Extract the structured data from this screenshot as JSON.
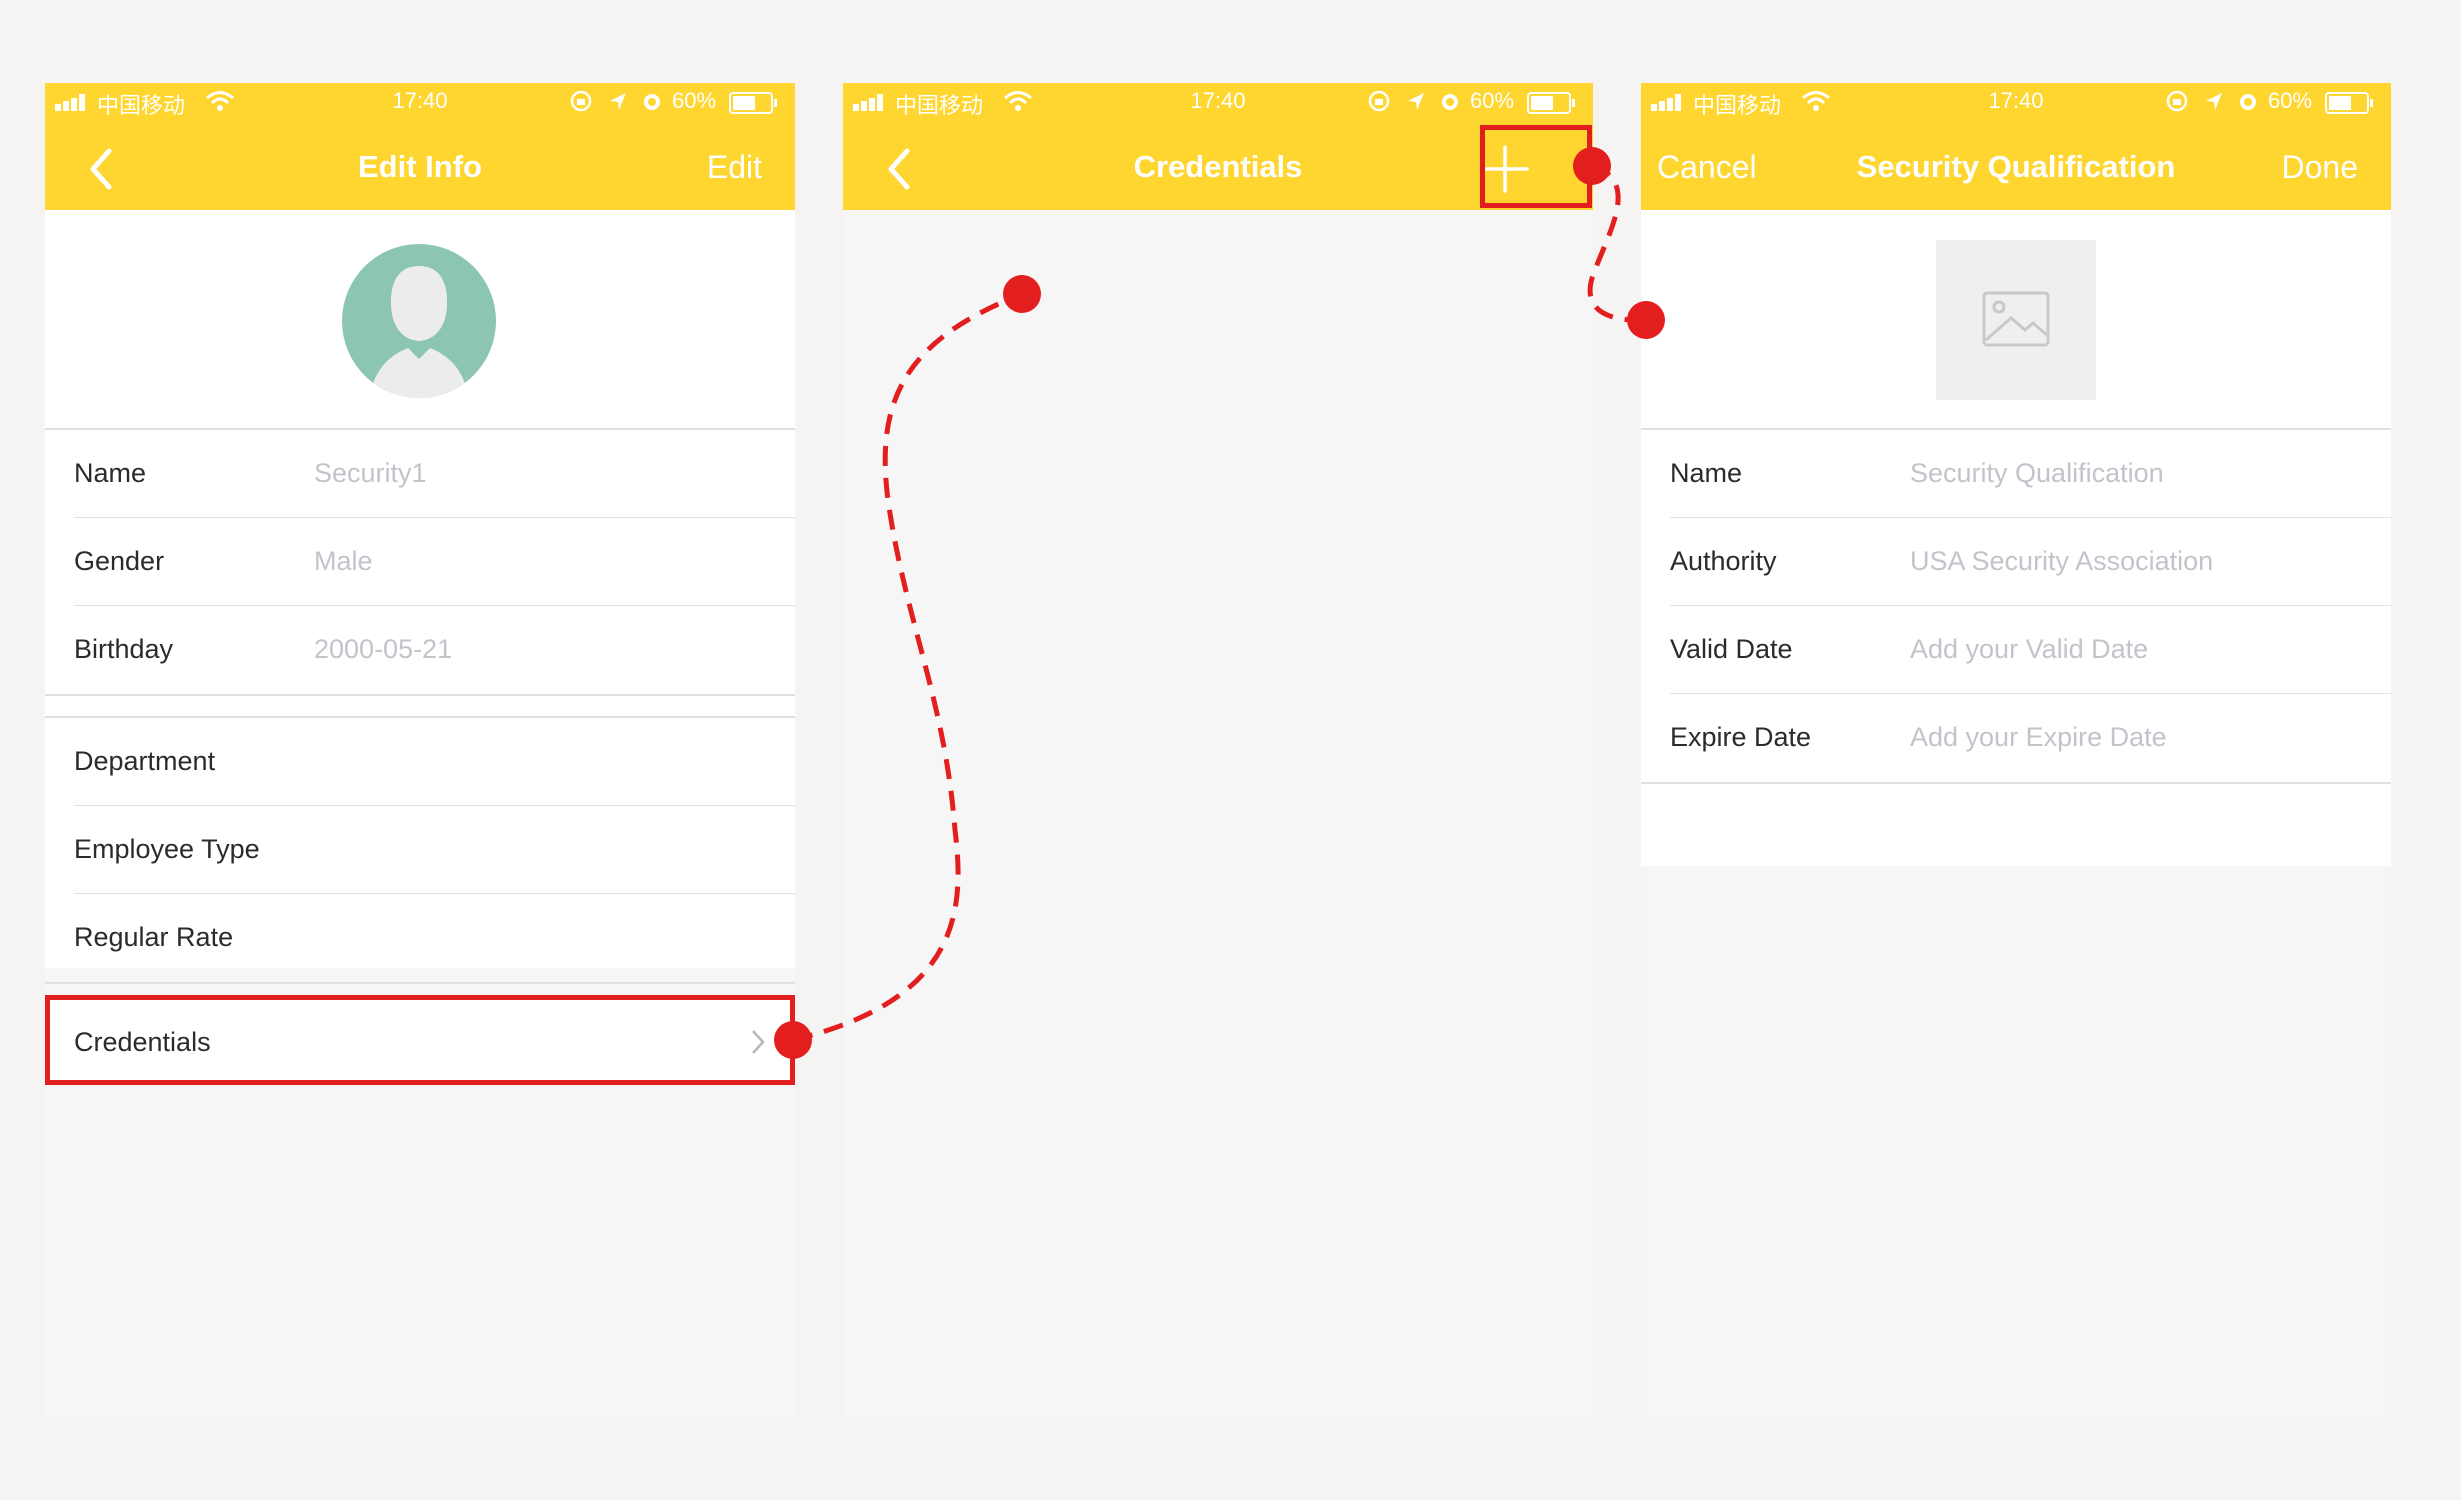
{
  "status_bar": {
    "carrier": "中国移动",
    "time": "17:40",
    "battery": "60%"
  },
  "screen1": {
    "nav": {
      "title": "Edit Info",
      "right": "Edit"
    },
    "profile": [
      {
        "label": "Name",
        "value": "Security1"
      },
      {
        "label": "Gender",
        "value": "Male"
      },
      {
        "label": "Birthday",
        "value": "2000-05-21"
      }
    ],
    "work": [
      {
        "label": "Department"
      },
      {
        "label": "Employee Type"
      },
      {
        "label": "Regular Rate"
      }
    ],
    "credentials_label": "Credentials"
  },
  "screen2": {
    "nav": {
      "title": "Credentials"
    }
  },
  "screen3": {
    "nav": {
      "left": "Cancel",
      "title": "Security Qualification",
      "right": "Done"
    },
    "fields": [
      {
        "label": "Name",
        "value": "Security Qualification"
      },
      {
        "label": "Authority",
        "value": "USA Security Association"
      },
      {
        "label": "Valid Date",
        "value": "Add your Valid Date"
      },
      {
        "label": "Expire Date",
        "value": "Add your Expire Date"
      }
    ]
  },
  "colors": {
    "nav_bar": "#ffd52f",
    "highlight": "#e21e1e",
    "avatar": "#8cc5b3",
    "placeholder_text": "#c3c3cb"
  },
  "icons": [
    "signal-icon",
    "wifi-icon",
    "lock-rotation-icon",
    "location-icon",
    "alarm-icon",
    "battery-icon",
    "back-chevron-icon",
    "plus-icon",
    "chevron-right-icon",
    "image-placeholder-icon",
    "avatar-icon"
  ]
}
